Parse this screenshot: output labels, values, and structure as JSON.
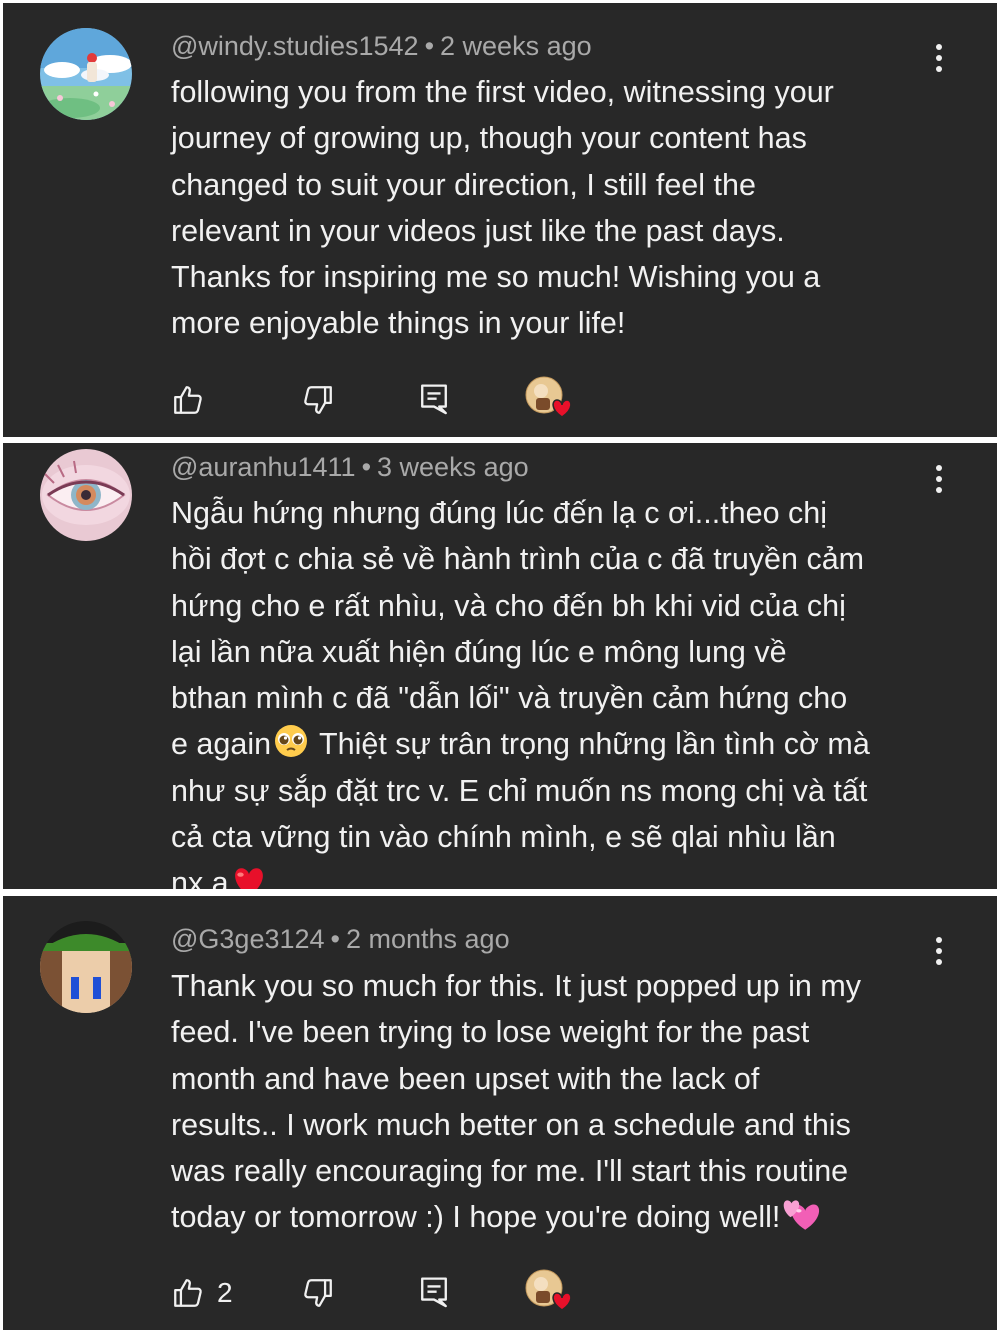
{
  "comments": [
    {
      "author": "@windy.studies1542",
      "time": "2 weeks ago",
      "lines": [
        "following you from the first video, witnessing your",
        "journey of growing up, though your content has",
        "changed to suit your direction, I still feel the",
        "relevant in your videos just like the past days.",
        "Thanks for inspiring me so much! Wishing you a",
        "more enjoyable things in your life!"
      ],
      "likes": ""
    },
    {
      "author": "@auranhu1411",
      "time": "3 weeks ago",
      "lines": [
        "Ngẫu hứng nhưng đúng lúc đến lạ c ơi...theo chị",
        "hồi đợt c chia sẻ về hành trình của c đã truyền cảm",
        "hứng cho e rất nhìu, và cho đến bh khi vid của chị",
        "lại lần nữa xuất hiện đúng lúc e mông lung về",
        "bthan mình c đã \"dẫn lối\" và truyền cảm hứng cho"
      ],
      "line6_before": "e again",
      "line6_after": " Thiệt sự trân trọng những lần tình cờ mà",
      "lines_after": [
        "như sự sắp đặt trc v. E chỉ muốn ns mong chị và tất",
        "cả cta vững tin vào chính mình, e sẽ qlai nhìu lần"
      ],
      "last_line": "nx a"
    },
    {
      "author": "@G3ge3124",
      "time": "2 months ago",
      "lines": [
        "Thank you so much for this. It just popped up in my",
        "feed. I've been trying to lose weight for the past",
        "month and have been upset with the lack of",
        "results.. I work much better on a schedule and this",
        "was really encouraging for me. I'll start this routine"
      ],
      "last_line": "today or tomorrow :) I hope you're doing well!",
      "likes": "2"
    }
  ],
  "separator": "•",
  "icons": {
    "like": "thumbs-up-icon",
    "dislike": "thumbs-down-icon",
    "reply": "reply-comment-icon",
    "more": "more-vertical-icon",
    "creator_heart": "creator-heart-icon"
  },
  "colors": {
    "background": "#282828",
    "text": "#f1f1f1",
    "meta": "#a9a9a9",
    "heart": "#e8102a"
  }
}
